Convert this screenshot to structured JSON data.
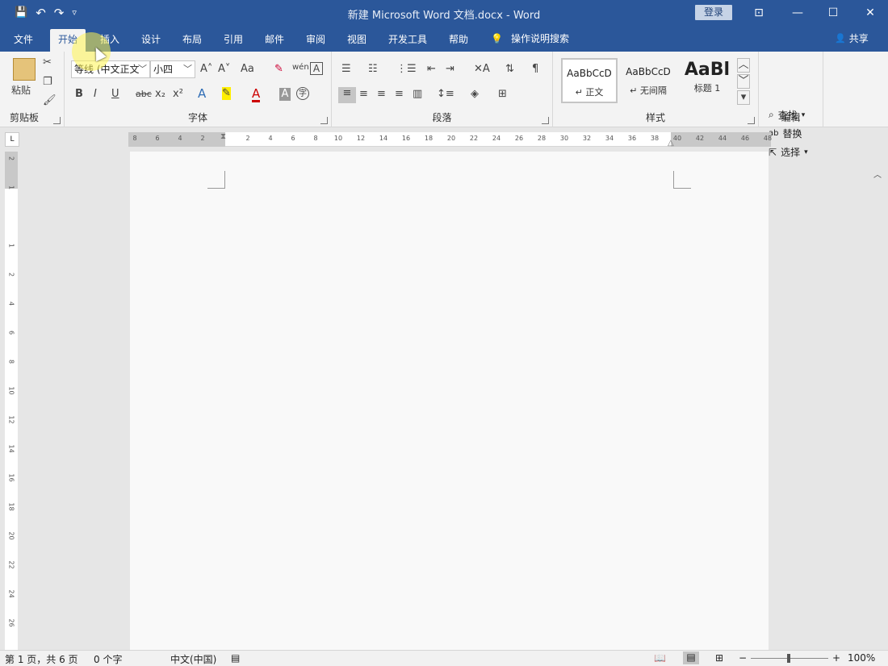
{
  "window": {
    "title": "新建 Microsoft Word 文档.docx  -  Word",
    "login_label": "登录",
    "min": "—",
    "max": "☐",
    "close": "✕",
    "restore_ribbon": "⊡"
  },
  "qat": {
    "save": "💾",
    "undo": "↶",
    "redo": "↷",
    "customize": "▿"
  },
  "tabs": [
    "文件",
    "开始",
    "插入",
    "设计",
    "布局",
    "引用",
    "邮件",
    "审阅",
    "视图",
    "开发工具",
    "帮助"
  ],
  "tellme": {
    "icon": "💡",
    "label": "操作说明搜索"
  },
  "share": {
    "icon": "👤",
    "label": "共享"
  },
  "ribbon": {
    "clipboard": {
      "paste": "粘贴",
      "group": "剪贴板"
    },
    "font": {
      "font_name": "等线 (中文正文",
      "font_size": "小四",
      "bold": "B",
      "italic": "I",
      "underline": "U",
      "strike": "abc",
      "sub": "x₂",
      "sup": "x²",
      "grow": "A˄",
      "shrink": "A˅",
      "case": "Aa",
      "group": "字体"
    },
    "paragraph": {
      "group": "段落"
    },
    "styles": {
      "items": [
        {
          "preview": "AaBbCcD",
          "name": "↵ 正文"
        },
        {
          "preview": "AaBbCcD",
          "name": "↵ 无间隔"
        },
        {
          "preview": "AaBl",
          "name": "标题 1"
        }
      ],
      "group": "样式"
    },
    "editing": {
      "find": "查找",
      "replace": "替换",
      "select": "选择",
      "group": "编辑"
    }
  },
  "ruler": {
    "corner": "L",
    "h_ticks": [
      "8",
      "6",
      "4",
      "2",
      "",
      "2",
      "4",
      "6",
      "8",
      "10",
      "12",
      "14",
      "16",
      "18",
      "20",
      "22",
      "24",
      "26",
      "28",
      "30",
      "32",
      "34",
      "36",
      "38",
      "40",
      "42",
      "44",
      "46",
      "48"
    ],
    "v_ticks": [
      "2",
      "1",
      "",
      "1",
      "2",
      "4",
      "6",
      "8",
      "10",
      "12",
      "14",
      "16",
      "18",
      "20",
      "22",
      "24",
      "26"
    ]
  },
  "status": {
    "page": "第 1 页，共 6 页",
    "words": "0 个字",
    "lang": "中文(中国)",
    "zoom": "100%",
    "minus": "−",
    "plus": "+"
  }
}
